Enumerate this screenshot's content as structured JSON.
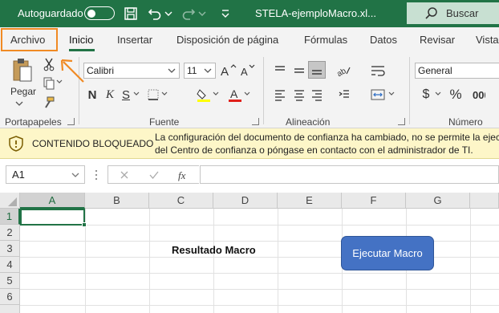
{
  "titlebar": {
    "autosave_label": "Autoguardado",
    "document_title": "STELA-ejemploMacro.xl...",
    "search_label": "Buscar"
  },
  "tabs": [
    {
      "label": "Archivo"
    },
    {
      "label": "Inicio"
    },
    {
      "label": "Insertar"
    },
    {
      "label": "Disposición de página"
    },
    {
      "label": "Fórmulas"
    },
    {
      "label": "Datos"
    },
    {
      "label": "Revisar"
    },
    {
      "label": "Vista"
    }
  ],
  "ribbon": {
    "paste_label": "Pegar",
    "font_name": "Calibri",
    "font_size": "11",
    "number_format": "General",
    "groups": {
      "clipboard": "Portapapeles",
      "font": "Fuente",
      "alignment": "Alineación",
      "number": "Número"
    },
    "bold": "N",
    "italic": "K",
    "underline": "S",
    "currency": "$",
    "percent": "%",
    "highlight_color": "#ffff00",
    "font_color": "#e0201b"
  },
  "message_bar": {
    "title": "CONTENIDO BLOQUEADO",
    "line1": "La configuración del documento de confianza ha cambiado, no se permite la ejec",
    "line2": "del Centro de confianza o póngase en contacto con el administrador de TI."
  },
  "formula_bar": {
    "name_box": "A1",
    "formula": ""
  },
  "grid": {
    "columns": [
      "A",
      "B",
      "C",
      "D",
      "E",
      "F",
      "G"
    ],
    "rows": [
      "1",
      "2",
      "3",
      "4",
      "5",
      "6"
    ],
    "cell_d3": "Resultado Macro",
    "macro_button": "Ejecutar Macro"
  },
  "colors": {
    "brand_green": "#217346",
    "highlight_orange": "#f08a24",
    "macro_button_blue": "#4472c4",
    "message_bar_bg": "#fdf6c8"
  }
}
